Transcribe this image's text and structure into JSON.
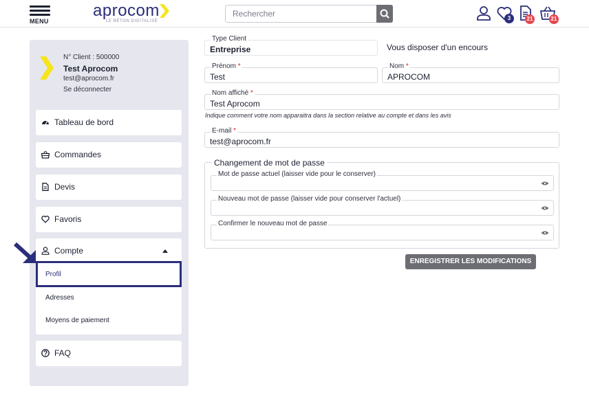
{
  "header": {
    "menu_label": "MENU",
    "logo_text": "aprocom",
    "logo_tagline": "LE BÉTON DIGITALISÉ",
    "search_placeholder": "Rechercher",
    "favorites_count": "3",
    "quotes_count": "21",
    "cart_count": "21"
  },
  "sidebar": {
    "client_no": "N° Client : 500000",
    "name": "Test Aprocom",
    "email": "test@aprocom.fr",
    "logout": "Se déconnecter",
    "items": [
      {
        "label": "Tableau de bord",
        "icon": "dashboard-icon"
      },
      {
        "label": "Commandes",
        "icon": "basket-icon"
      },
      {
        "label": "Devis",
        "icon": "document-icon"
      },
      {
        "label": "Favoris",
        "icon": "heart-icon"
      },
      {
        "label": "Compte",
        "icon": "user-icon"
      },
      {
        "label": "FAQ",
        "icon": "question-icon"
      }
    ],
    "compte_sub": [
      "Profil",
      "Adresses",
      "Moyens de paiement"
    ]
  },
  "form": {
    "type_client_label": "Type Client",
    "type_client_value": "Entreprise",
    "encours_text": "Vous disposer d'un encours",
    "prenom_label": "Prénom",
    "prenom_value": "Test",
    "nom_label": "Nom",
    "nom_value": "APROCOM",
    "display_label": "Nom affiché",
    "display_value": "Test Aprocom",
    "display_note": "Indique comment votre nom apparaitra dans la section relative au compte et dans les avis",
    "email_label": "E-mail",
    "email_value": "test@aprocom.fr",
    "required_mark": "*",
    "password_legend": "Changement de mot de passe",
    "current_pw_label": "Mot de passe actuel (laisser vide pour le conserver)",
    "new_pw_label": "Nouveau mot de passe (laisser vide pour conserver l'actuel)",
    "confirm_pw_label": "Confirmer le nouveau mot de passe",
    "save_label": "ENREGISTRER LES MODIFICATIONS"
  },
  "colors": {
    "brand_navy": "#2b2e7a",
    "brand_yellow": "#f5e51b",
    "badge_red": "#e8474f",
    "button_gray": "#6d6e73"
  }
}
